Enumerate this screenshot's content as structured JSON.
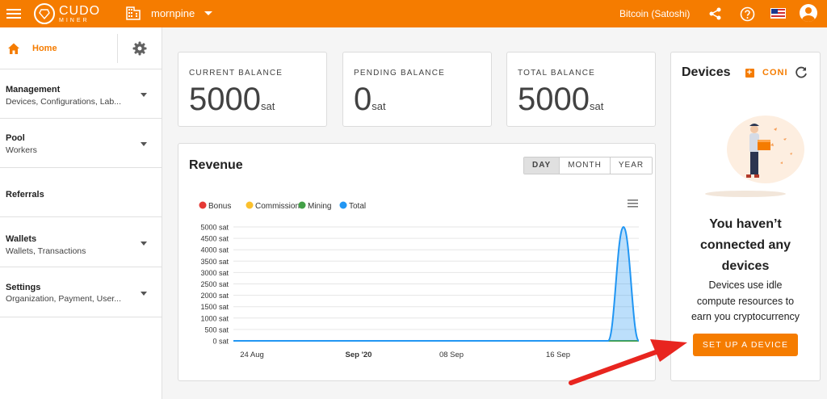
{
  "topbar": {
    "logo_word": "CUDO",
    "logo_sub": "MINER",
    "org_name": "mornpine",
    "currency": "Bitcoin (Satoshi)",
    "icons": [
      "menu-icon",
      "building-icon",
      "share-icon",
      "help-icon",
      "us-flag-icon",
      "account-icon"
    ]
  },
  "sidebar": {
    "home": "Home",
    "items": [
      {
        "title": "Management",
        "sub": "Devices, Configurations, Lab..."
      },
      {
        "title": "Pool",
        "sub": "Workers"
      },
      {
        "title": "Referrals",
        "sub": ""
      },
      {
        "title": "Wallets",
        "sub": "Wallets, Transactions"
      },
      {
        "title": "Settings",
        "sub": "Organization, Payment, User..."
      }
    ]
  },
  "balances": [
    {
      "label": "CURRENT BALANCE",
      "value": "5000",
      "unit": "sat"
    },
    {
      "label": "PENDING BALANCE",
      "value": "0",
      "unit": "sat"
    },
    {
      "label": "TOTAL BALANCE",
      "value": "5000",
      "unit": "sat"
    }
  ],
  "revenue": {
    "title": "Revenue",
    "periods": [
      "DAY",
      "MONTH",
      "YEAR"
    ],
    "selected_period": "DAY"
  },
  "colors": {
    "accent": "#f57c00",
    "bonus": "#e53935",
    "commission": "#fbc02d",
    "mining": "#43a047",
    "total": "#2196f3",
    "arrow": "#e8251f"
  },
  "chart_data": {
    "type": "area",
    "legend": [
      "Bonus",
      "Commission",
      "Mining",
      "Total"
    ],
    "y_ticks": [
      "5000 sat",
      "4500 sat",
      "4000 sat",
      "3500 sat",
      "3000 sat",
      "2500 sat",
      "2000 sat",
      "1500 sat",
      "1000 sat",
      "500 sat",
      "0 sat"
    ],
    "x_ticks": [
      "24 Aug",
      "Sep '20",
      "08 Sep",
      "16 Sep"
    ],
    "ylim": [
      0,
      5000
    ],
    "series": [
      {
        "name": "Bonus",
        "values": [
          0,
          0
        ]
      },
      {
        "name": "Commission",
        "values": [
          0,
          0
        ]
      },
      {
        "name": "Mining",
        "values": [
          0,
          0
        ]
      },
      {
        "name": "Total",
        "x": [
          "2020-08-19",
          "2020-09-21",
          "2020-09-24",
          "2020-09-27"
        ],
        "values": [
          0,
          0,
          5000,
          0
        ]
      }
    ],
    "grid": true,
    "legend_placement": "top-left"
  },
  "devices": {
    "title": "Devices",
    "add_label": "CONNECT",
    "add_label_visible": "CONI",
    "heading_lines": [
      "You haven’t",
      "connected any",
      "devices"
    ],
    "text_lines": [
      "Devices use idle",
      "compute resources to",
      "earn you cryptocurrency"
    ],
    "button": "SET UP A DEVICE"
  }
}
